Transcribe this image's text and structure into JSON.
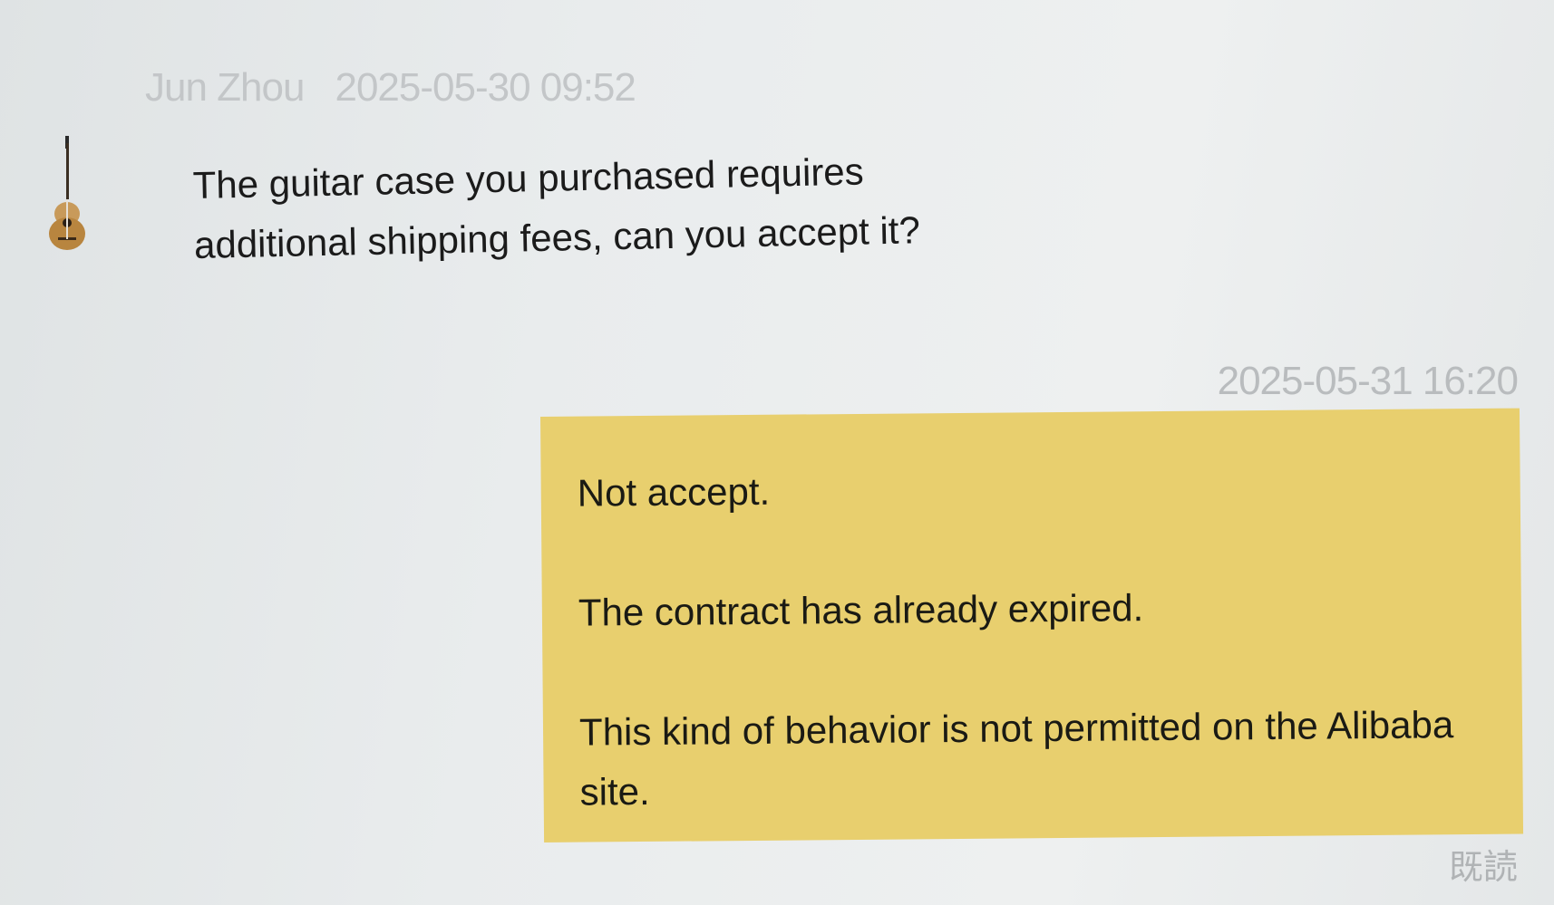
{
  "incoming": {
    "sender": "Jun Zhou",
    "timestamp": "2025-05-30 09:52",
    "avatar_icon": "guitar-icon",
    "lines": [
      "The guitar case you purchased requires",
      "additional shipping fees, can you accept it?"
    ]
  },
  "outgoing": {
    "timestamp": "2025-05-31 16:20",
    "bubble_color": "#e8cf6e",
    "paragraphs": [
      "Not accept.",
      "The contract has already expired.",
      "This kind of behavior is not permitted on the Alibaba site."
    ],
    "read_status": "既読"
  }
}
